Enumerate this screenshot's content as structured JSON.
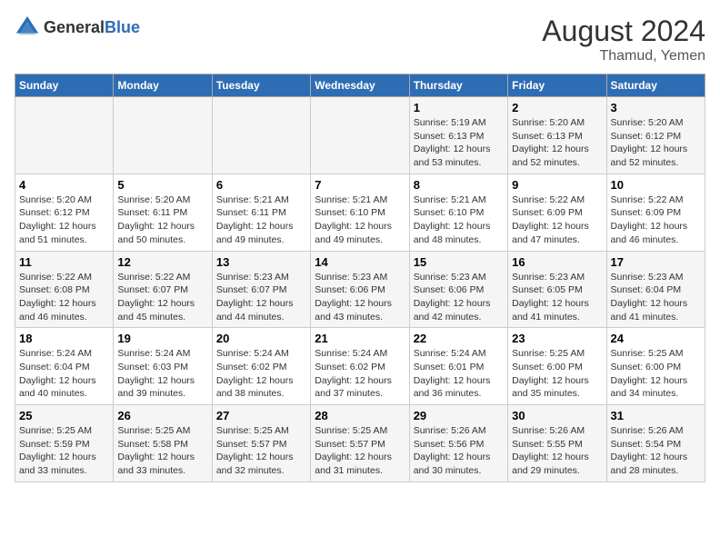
{
  "logo": {
    "text_general": "General",
    "text_blue": "Blue"
  },
  "title": "August 2024",
  "subtitle": "Thamud, Yemen",
  "days_of_week": [
    "Sunday",
    "Monday",
    "Tuesday",
    "Wednesday",
    "Thursday",
    "Friday",
    "Saturday"
  ],
  "weeks": [
    [
      {
        "day": "",
        "info": ""
      },
      {
        "day": "",
        "info": ""
      },
      {
        "day": "",
        "info": ""
      },
      {
        "day": "",
        "info": ""
      },
      {
        "day": "1",
        "info": "Sunrise: 5:19 AM\nSunset: 6:13 PM\nDaylight: 12 hours\nand 53 minutes."
      },
      {
        "day": "2",
        "info": "Sunrise: 5:20 AM\nSunset: 6:13 PM\nDaylight: 12 hours\nand 52 minutes."
      },
      {
        "day": "3",
        "info": "Sunrise: 5:20 AM\nSunset: 6:12 PM\nDaylight: 12 hours\nand 52 minutes."
      }
    ],
    [
      {
        "day": "4",
        "info": "Sunrise: 5:20 AM\nSunset: 6:12 PM\nDaylight: 12 hours\nand 51 minutes."
      },
      {
        "day": "5",
        "info": "Sunrise: 5:20 AM\nSunset: 6:11 PM\nDaylight: 12 hours\nand 50 minutes."
      },
      {
        "day": "6",
        "info": "Sunrise: 5:21 AM\nSunset: 6:11 PM\nDaylight: 12 hours\nand 49 minutes."
      },
      {
        "day": "7",
        "info": "Sunrise: 5:21 AM\nSunset: 6:10 PM\nDaylight: 12 hours\nand 49 minutes."
      },
      {
        "day": "8",
        "info": "Sunrise: 5:21 AM\nSunset: 6:10 PM\nDaylight: 12 hours\nand 48 minutes."
      },
      {
        "day": "9",
        "info": "Sunrise: 5:22 AM\nSunset: 6:09 PM\nDaylight: 12 hours\nand 47 minutes."
      },
      {
        "day": "10",
        "info": "Sunrise: 5:22 AM\nSunset: 6:09 PM\nDaylight: 12 hours\nand 46 minutes."
      }
    ],
    [
      {
        "day": "11",
        "info": "Sunrise: 5:22 AM\nSunset: 6:08 PM\nDaylight: 12 hours\nand 46 minutes."
      },
      {
        "day": "12",
        "info": "Sunrise: 5:22 AM\nSunset: 6:07 PM\nDaylight: 12 hours\nand 45 minutes."
      },
      {
        "day": "13",
        "info": "Sunrise: 5:23 AM\nSunset: 6:07 PM\nDaylight: 12 hours\nand 44 minutes."
      },
      {
        "day": "14",
        "info": "Sunrise: 5:23 AM\nSunset: 6:06 PM\nDaylight: 12 hours\nand 43 minutes."
      },
      {
        "day": "15",
        "info": "Sunrise: 5:23 AM\nSunset: 6:06 PM\nDaylight: 12 hours\nand 42 minutes."
      },
      {
        "day": "16",
        "info": "Sunrise: 5:23 AM\nSunset: 6:05 PM\nDaylight: 12 hours\nand 41 minutes."
      },
      {
        "day": "17",
        "info": "Sunrise: 5:23 AM\nSunset: 6:04 PM\nDaylight: 12 hours\nand 41 minutes."
      }
    ],
    [
      {
        "day": "18",
        "info": "Sunrise: 5:24 AM\nSunset: 6:04 PM\nDaylight: 12 hours\nand 40 minutes."
      },
      {
        "day": "19",
        "info": "Sunrise: 5:24 AM\nSunset: 6:03 PM\nDaylight: 12 hours\nand 39 minutes."
      },
      {
        "day": "20",
        "info": "Sunrise: 5:24 AM\nSunset: 6:02 PM\nDaylight: 12 hours\nand 38 minutes."
      },
      {
        "day": "21",
        "info": "Sunrise: 5:24 AM\nSunset: 6:02 PM\nDaylight: 12 hours\nand 37 minutes."
      },
      {
        "day": "22",
        "info": "Sunrise: 5:24 AM\nSunset: 6:01 PM\nDaylight: 12 hours\nand 36 minutes."
      },
      {
        "day": "23",
        "info": "Sunrise: 5:25 AM\nSunset: 6:00 PM\nDaylight: 12 hours\nand 35 minutes."
      },
      {
        "day": "24",
        "info": "Sunrise: 5:25 AM\nSunset: 6:00 PM\nDaylight: 12 hours\nand 34 minutes."
      }
    ],
    [
      {
        "day": "25",
        "info": "Sunrise: 5:25 AM\nSunset: 5:59 PM\nDaylight: 12 hours\nand 33 minutes."
      },
      {
        "day": "26",
        "info": "Sunrise: 5:25 AM\nSunset: 5:58 PM\nDaylight: 12 hours\nand 33 minutes."
      },
      {
        "day": "27",
        "info": "Sunrise: 5:25 AM\nSunset: 5:57 PM\nDaylight: 12 hours\nand 32 minutes."
      },
      {
        "day": "28",
        "info": "Sunrise: 5:25 AM\nSunset: 5:57 PM\nDaylight: 12 hours\nand 31 minutes."
      },
      {
        "day": "29",
        "info": "Sunrise: 5:26 AM\nSunset: 5:56 PM\nDaylight: 12 hours\nand 30 minutes."
      },
      {
        "day": "30",
        "info": "Sunrise: 5:26 AM\nSunset: 5:55 PM\nDaylight: 12 hours\nand 29 minutes."
      },
      {
        "day": "31",
        "info": "Sunrise: 5:26 AM\nSunset: 5:54 PM\nDaylight: 12 hours\nand 28 minutes."
      }
    ]
  ]
}
